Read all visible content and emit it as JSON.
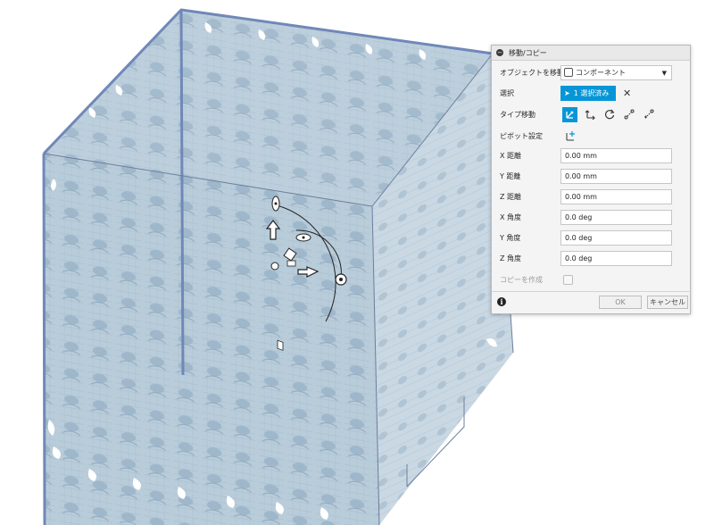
{
  "panel": {
    "title": "移動/コピー",
    "move_object": {
      "label": "オブジェクトを移動",
      "value": "コンポーネント"
    },
    "selection": {
      "label": "選択",
      "button": "1 選択済み"
    },
    "move_type": {
      "label": "タイプ移動"
    },
    "pivot": {
      "label": "ピボット設定"
    },
    "fields": [
      {
        "label": "X 距離",
        "value": "0.00 mm"
      },
      {
        "label": "Y 距離",
        "value": "0.00 mm"
      },
      {
        "label": "Z 距離",
        "value": "0.00 mm"
      },
      {
        "label": "X 角度",
        "value": "0.0 deg"
      },
      {
        "label": "Y 角度",
        "value": "0.0 deg"
      },
      {
        "label": "Z 角度",
        "value": "0.0 deg"
      }
    ],
    "create_copy": {
      "label": "コピーを作成"
    },
    "ok_label": "OK",
    "cancel_label": "キャンセル"
  },
  "colors": {
    "accent": "#0696d7",
    "cube_edge": "#7088b8",
    "lattice_fill": "#b7cbd9"
  }
}
